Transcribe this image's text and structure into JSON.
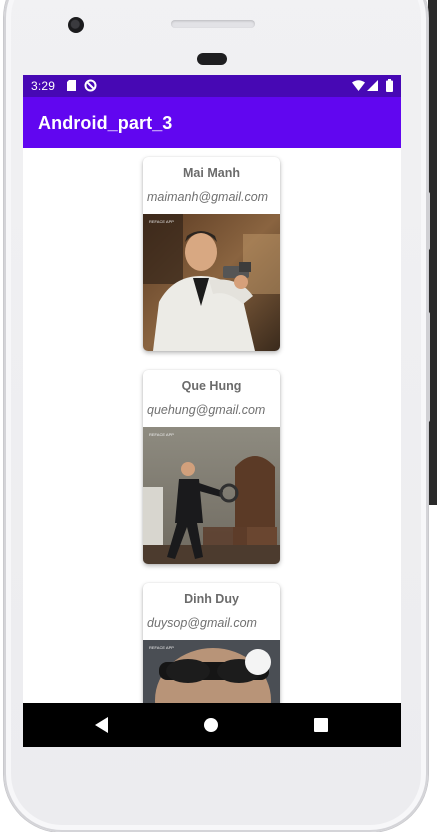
{
  "status_bar": {
    "time": "3:29",
    "left_icons": [
      "sd-card-icon",
      "no-signal-circle-icon"
    ],
    "right_icons": [
      "wifi-icon",
      "cell-signal-icon",
      "battery-icon"
    ],
    "color": "#4708b4"
  },
  "app_bar": {
    "title": "Android_part_3",
    "color": "#6106f0"
  },
  "contacts": [
    {
      "name": "Mai Manh",
      "email": "maimanh@gmail.com",
      "photo_watermark": "REFACE APP"
    },
    {
      "name": "Que Hung",
      "email": "quehung@gmail.com",
      "photo_watermark": "REFACE APP"
    },
    {
      "name": "Dinh Duy",
      "email": "duysop@gmail.com",
      "photo_watermark": "REFACE APP"
    }
  ],
  "nav_bar": {
    "buttons": [
      "back-icon",
      "home-icon",
      "recents-icon"
    ]
  }
}
